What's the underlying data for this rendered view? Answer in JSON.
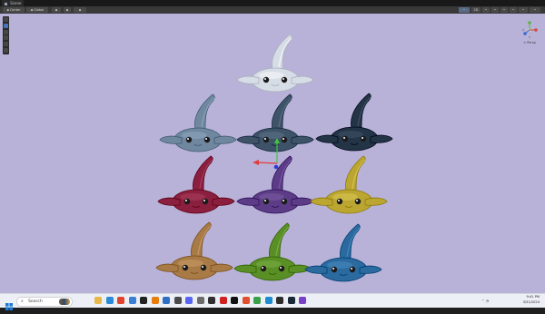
{
  "window": {
    "tab_title": "Scene"
  },
  "toolbar": {
    "left": [
      {
        "name": "pivot-toggle",
        "label": "Center",
        "icon": "pivot-icon"
      },
      {
        "name": "space-toggle",
        "label": "Global",
        "icon": "global-icon"
      },
      {
        "name": "grid-toggle",
        "label": "",
        "icon": "grid-icon"
      },
      {
        "name": "snap-toggle",
        "label": "",
        "icon": "magnet-icon"
      },
      {
        "name": "increment-toggle",
        "label": "",
        "icon": "increment-icon"
      }
    ],
    "right": [
      {
        "name": "render-mode",
        "label": "",
        "icon": "sphere-icon"
      },
      {
        "name": "dimension-toggle",
        "label": "2D",
        "icon": ""
      },
      {
        "name": "lighting-toggle",
        "label": "",
        "icon": "lightbulb-icon"
      },
      {
        "name": "audio-toggle",
        "label": "",
        "icon": "speaker-icon"
      },
      {
        "name": "effects-toggle",
        "label": "",
        "icon": "effects-icon"
      },
      {
        "name": "hidden-toggle",
        "label": "",
        "icon": "eye-icon"
      },
      {
        "name": "camera-settings",
        "label": "",
        "icon": "camera-icon"
      },
      {
        "name": "gizmos-toggle",
        "label": "",
        "icon": "globe-icon"
      }
    ]
  },
  "tools": [
    "view-tool-icon",
    "move-tool-icon",
    "rotate-tool-icon",
    "scale-tool-icon",
    "rect-tool-icon",
    "transform-tool-icon"
  ],
  "scene": {
    "background_color": "#b8b2d8",
    "gizmo_label": "< Persp",
    "creatures": [
      {
        "name": "creature-white",
        "color": "#d7dde6"
      },
      {
        "name": "creature-slate",
        "color": "#6f879f"
      },
      {
        "name": "creature-steel",
        "color": "#3e5268"
      },
      {
        "name": "creature-navy",
        "color": "#233447"
      },
      {
        "name": "creature-crimson",
        "color": "#8a1f3f"
      },
      {
        "name": "creature-purple",
        "color": "#5c3c86"
      },
      {
        "name": "creature-olive",
        "color": "#bba632"
      },
      {
        "name": "creature-tan",
        "color": "#a87a46"
      },
      {
        "name": "creature-green",
        "color": "#5a8f26"
      },
      {
        "name": "creature-blue",
        "color": "#2a6a9e"
      }
    ]
  },
  "taskbar": {
    "search_placeholder": "Search",
    "time": "9:41 PM",
    "date": "3/31/2024",
    "apps": [
      {
        "name": "file-explorer-icon",
        "color": "#e6b84a"
      },
      {
        "name": "edge-icon",
        "color": "#2a8ad6"
      },
      {
        "name": "chrome-icon",
        "color": "#e0442c"
      },
      {
        "name": "store-icon",
        "color": "#3a7ed6"
      },
      {
        "name": "unity-icon",
        "color": "#222222"
      },
      {
        "name": "blender-icon",
        "color": "#e87d0d"
      },
      {
        "name": "mail-icon",
        "color": "#2d6fc4"
      },
      {
        "name": "calculator-icon",
        "color": "#4a4a4a"
      },
      {
        "name": "discord-icon",
        "color": "#5865f2"
      },
      {
        "name": "settings-icon",
        "color": "#6b6b6b"
      },
      {
        "name": "obs-icon",
        "color": "#302e31"
      },
      {
        "name": "record-icon",
        "color": "#d02020"
      },
      {
        "name": "tiktok-icon",
        "color": "#111111"
      },
      {
        "name": "photos-icon",
        "color": "#e0502c"
      },
      {
        "name": "chrome-2-icon",
        "color": "#3aa04a"
      },
      {
        "name": "paint-icon",
        "color": "#1e8ad0"
      },
      {
        "name": "terminal-icon",
        "color": "#2c2c2c"
      },
      {
        "name": "steam-icon",
        "color": "#1b2838"
      },
      {
        "name": "media-icon",
        "color": "#7a40c8"
      }
    ]
  }
}
